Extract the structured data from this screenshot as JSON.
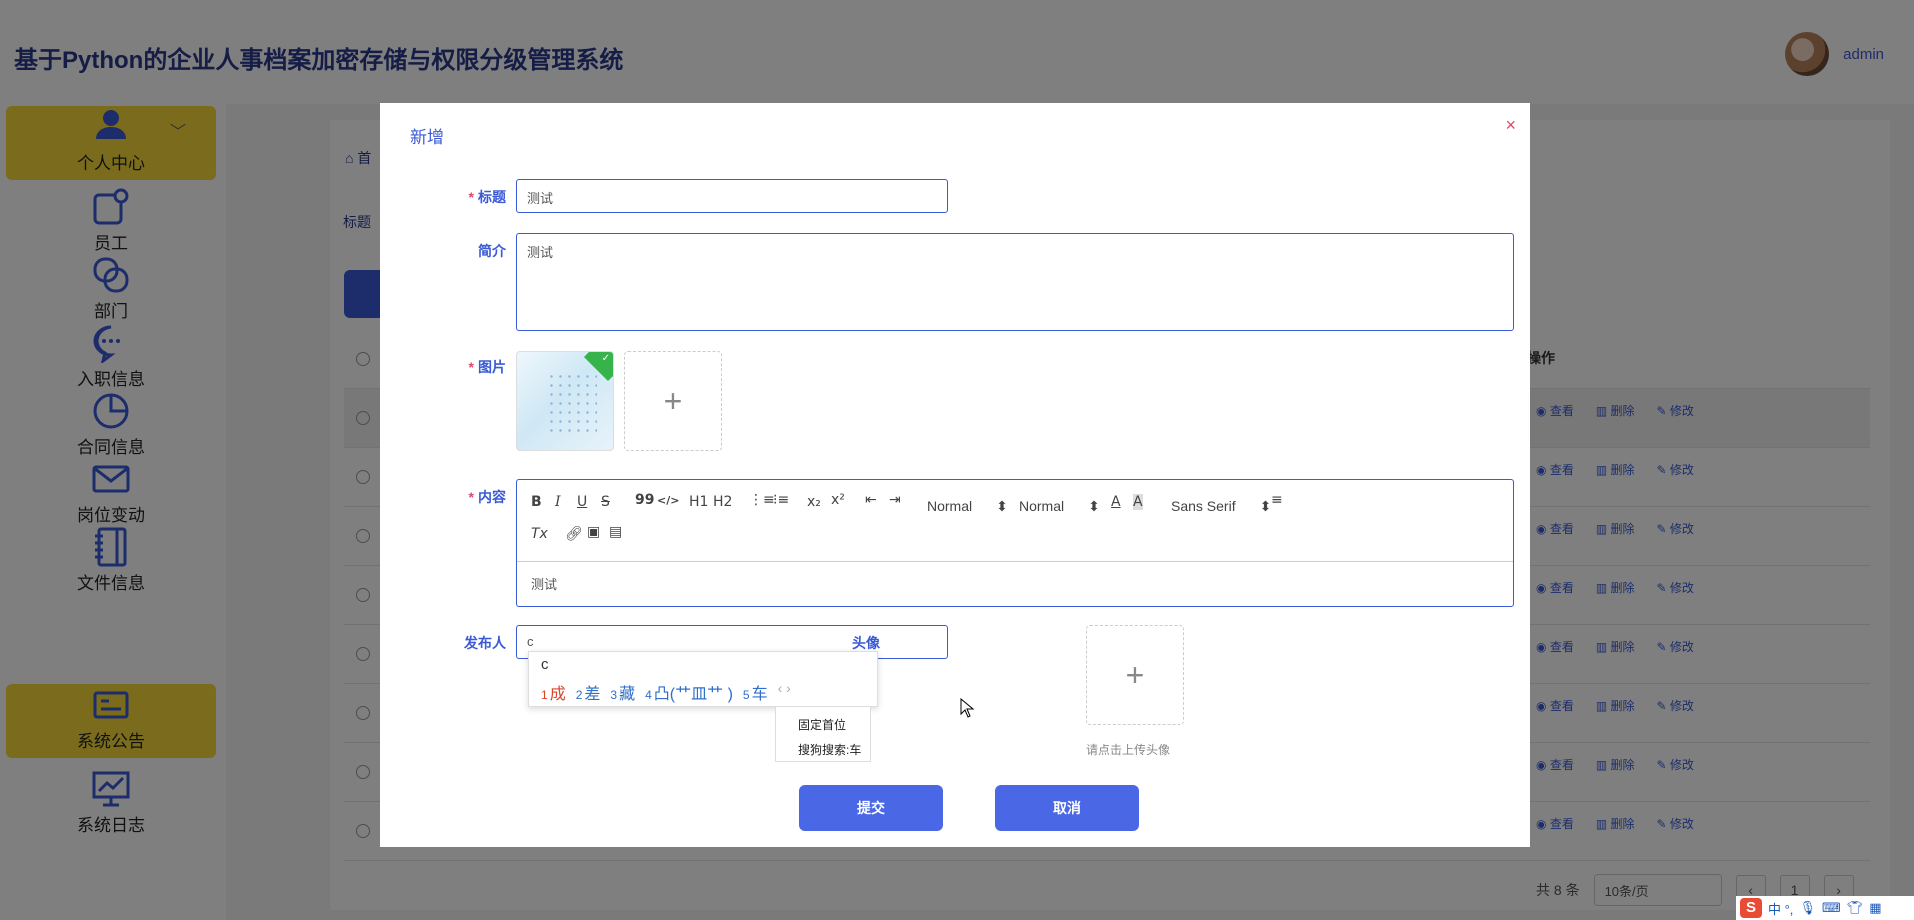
{
  "app": {
    "title": "基于Python的企业人事档案加密存储与权限分级管理系统",
    "user": "admin"
  },
  "sidebar": {
    "items": [
      {
        "label": "个人中心",
        "icon": "person-icon",
        "active": true
      },
      {
        "label": "员工",
        "icon": "employee-icon",
        "active": false
      },
      {
        "label": "部门",
        "icon": "department-icon",
        "active": false
      },
      {
        "label": "入职信息",
        "icon": "chat-icon",
        "active": false
      },
      {
        "label": "合同信息",
        "icon": "pie-chart-icon",
        "active": false
      },
      {
        "label": "岗位变动",
        "icon": "mail-icon",
        "active": false
      },
      {
        "label": "文件信息",
        "icon": "notebook-icon",
        "active": false
      },
      {
        "label": "系统公告",
        "icon": "notice-icon",
        "active": true
      },
      {
        "label": "系统日志",
        "icon": "chart-board-icon",
        "active": false
      }
    ]
  },
  "background": {
    "breadcrumb": "首",
    "filter_label": "标题",
    "ops_header": "操作",
    "row_actions": {
      "view": "查看",
      "delete": "删除",
      "edit": "修改"
    },
    "pager": {
      "total": "共 8 条",
      "page_size": "10条/页",
      "page": "1"
    }
  },
  "dialog": {
    "title": "新增",
    "close": "×",
    "fields": {
      "title": {
        "label": "标题",
        "value": "测试"
      },
      "intro": {
        "label": "简介",
        "value": "测试"
      },
      "image": {
        "label": "图片"
      },
      "content": {
        "label": "内容",
        "value": "测试"
      },
      "publisher": {
        "label": "发布人",
        "value": "c"
      },
      "avatar": {
        "label": "头像",
        "hint": "请点击上传头像"
      }
    },
    "editor_toolbar": {
      "bold": "B",
      "italic": "I",
      "underline": "U",
      "strike": "S",
      "quote": "99",
      "code": "</>",
      "h1": "H1",
      "h2": "H2",
      "sub": "x₂",
      "sup": "x²",
      "size_select": "Normal",
      "header_select": "Normal",
      "font_select": "Sans Serif",
      "clean": "Tx"
    },
    "submit": "提交",
    "cancel": "取消"
  },
  "ime": {
    "code": "c",
    "candidates": [
      {
        "n": "1",
        "text": "成"
      },
      {
        "n": "2",
        "text": "差"
      },
      {
        "n": "3",
        "text": "藏"
      },
      {
        "n": "4",
        "text": "凸(艹皿艹 )"
      },
      {
        "n": "5",
        "text": "车"
      }
    ],
    "arrows": "‹ ›",
    "menu": [
      "固定首位",
      "搜狗搜索:车"
    ],
    "tray": "中 °, "
  }
}
